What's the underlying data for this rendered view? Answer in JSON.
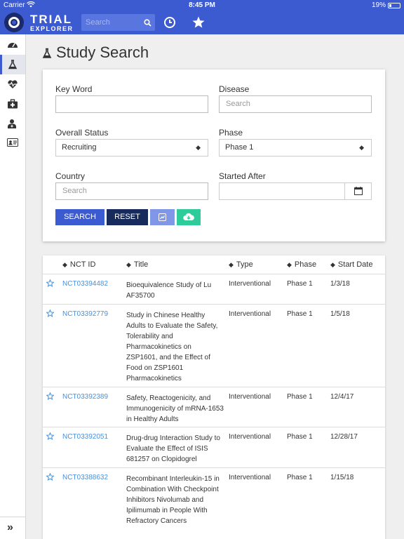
{
  "status_bar": {
    "carrier": "Carrier",
    "time": "8:45 PM",
    "battery": "19%"
  },
  "header": {
    "logo_line1": "TRIAL",
    "logo_line2": "EXPLORER",
    "search_placeholder": "Search"
  },
  "sidebar": {
    "items": [
      {
        "icon": "dashboard-icon"
      },
      {
        "icon": "flask-icon",
        "active": true
      },
      {
        "icon": "heartbeat-icon"
      },
      {
        "icon": "medkit-icon"
      },
      {
        "icon": "user-md-icon"
      },
      {
        "icon": "id-card-icon"
      }
    ],
    "expand_label": "»"
  },
  "page": {
    "title": "Study Search"
  },
  "form": {
    "keyword_label": "Key Word",
    "keyword_value": "",
    "disease_label": "Disease",
    "disease_placeholder": "Search",
    "status_label": "Overall Status",
    "status_value": "Recruiting",
    "phase_label": "Phase",
    "phase_value": "Phase 1",
    "country_label": "Country",
    "country_placeholder": "Search",
    "started_label": "Started After",
    "started_value": "",
    "search_button": "SEARCH",
    "reset_button": "RESET",
    "colors": {
      "search": "#3d5bd0",
      "reset": "#172a5c",
      "chart": "#7f97e6",
      "download": "#2ecc9a"
    }
  },
  "table": {
    "headers": {
      "nct": "NCT ID",
      "title": "Title",
      "type": "Type",
      "phase": "Phase",
      "start": "Start Date"
    },
    "rows": [
      {
        "nct": "NCT03394482",
        "title": "Bioequivalence Study of Lu AF35700",
        "type": "Interventional",
        "phase": "Phase 1",
        "date": "1/3/18"
      },
      {
        "nct": "NCT03392779",
        "title": "Study in Chinese Healthy Adults to Evaluate the Safety, Tolerability and Pharmacokinetics on ZSP1601, and the Effect of Food on ZSP1601 Pharmacokinetics",
        "type": "Interventional",
        "phase": "Phase 1",
        "date": "1/5/18"
      },
      {
        "nct": "NCT03392389",
        "title": "Safety, Reactogenicity, and Immunogenicity of mRNA-1653 in Healthy Adults",
        "type": "Interventional",
        "phase": "Phase 1",
        "date": "12/4/17"
      },
      {
        "nct": "NCT03392051",
        "title": "Drug-drug Interaction Study to Evaluate the Effect of ISIS 681257 on Clopidogrel",
        "type": "Interventional",
        "phase": "Phase 1",
        "date": "12/28/17"
      },
      {
        "nct": "NCT03388632",
        "title": "Recombinant Interleukin-15 in Combination With Checkpoint Inhibitors Nivolumab and Ipilimumab in People With Refractory Cancers",
        "type": "Interventional",
        "phase": "Phase 1",
        "date": "1/15/18"
      }
    ]
  }
}
